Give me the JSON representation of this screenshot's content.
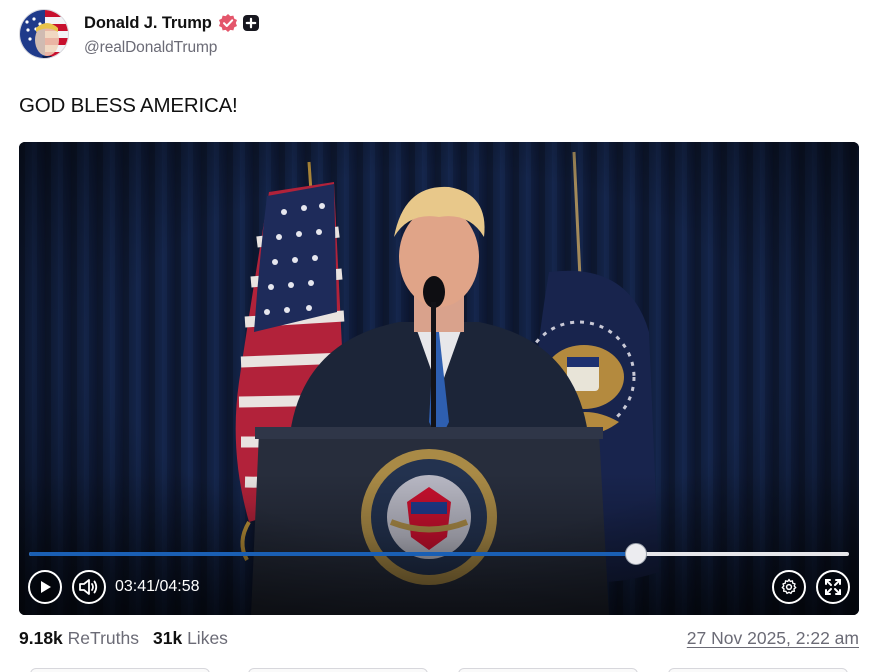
{
  "author": {
    "display_name": "Donald J. Trump",
    "handle": "@realDonaldTrump",
    "verified": true,
    "badges": [
      "verified-badge-icon",
      "plus-badge-icon"
    ]
  },
  "post": {
    "text": "GOD BLESS AMERICA!",
    "timestamp": "27 Nov 2025, 2:22 am"
  },
  "video": {
    "current_time": "03:41",
    "separator": "/",
    "duration": "04:58",
    "progress_fraction": 0.74,
    "controls": [
      "play-icon",
      "volume-icon",
      "settings-gear-icon",
      "fullscreen-icon"
    ],
    "accent_color": "#1a5fb4"
  },
  "stats": {
    "retruths_count": "9.18k",
    "retruths_label": "ReTruths",
    "likes_count": "31k",
    "likes_label": "Likes"
  }
}
